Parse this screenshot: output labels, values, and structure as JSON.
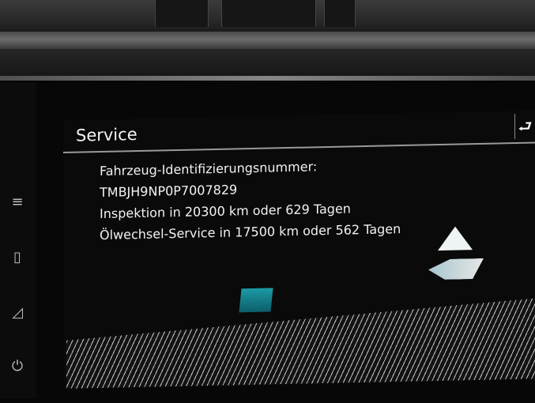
{
  "screen": {
    "title": "Service",
    "back_icon": "back-arrow-icon",
    "lines": [
      "Fahrzeug-Identifizierungsnummer:",
      "TMBJH9NP0P7007829",
      "Inspektion in 20300 km oder 629 Tagen",
      "Ölwechsel-Service in 17500 km oder 562 Tagen"
    ]
  },
  "left_rail": {
    "icons": [
      "menu-icon",
      "phone-icon",
      "car-icon",
      "power-icon"
    ]
  },
  "colors": {
    "background": "#0a0a0a",
    "text": "#f2f2f2",
    "accent": "#1c9aa6"
  }
}
